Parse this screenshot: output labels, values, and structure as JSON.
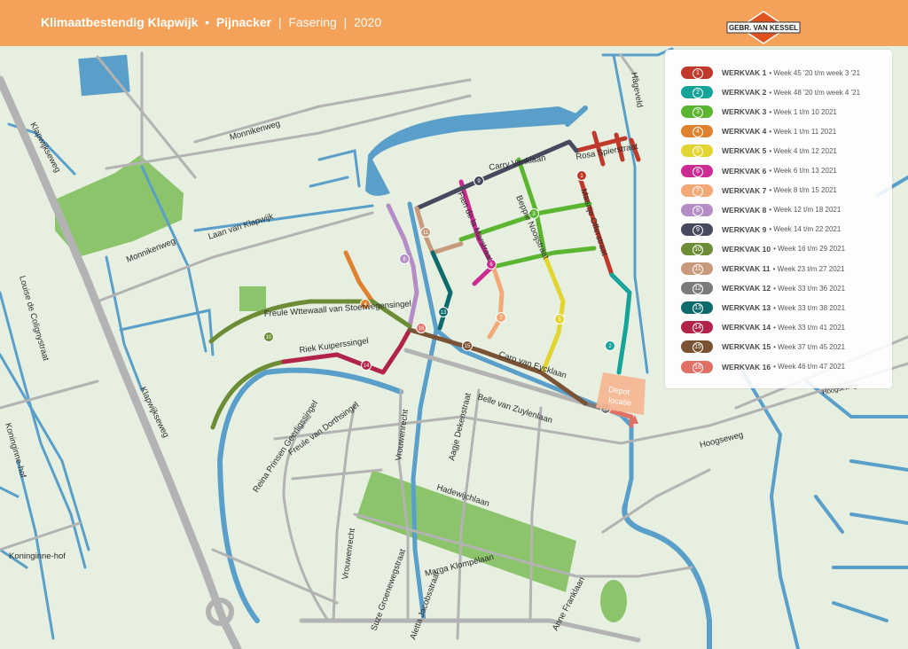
{
  "header": {
    "title": "Klimaatbestendig Klapwijk",
    "place": "Pijnacker",
    "subject": "Fasering",
    "year": "2020",
    "bullet": "•",
    "sep": "|"
  },
  "logo": {
    "text": "GEBR. VAN KESSEL"
  },
  "legend": [
    {
      "n": "1",
      "name": "WERKVAK 1",
      "weeks": "Week 45 '20 t/m week 3 '21",
      "color": "#c0392b"
    },
    {
      "n": "2",
      "name": "WERKVAK 2",
      "weeks": "Week 48 '20 t/m week 4 '21",
      "color": "#16a39a"
    },
    {
      "n": "3",
      "name": "WERKVAK 3",
      "weeks": "Week 1 t/m 10 2021",
      "color": "#5cb531"
    },
    {
      "n": "4",
      "name": "WERKVAK 4",
      "weeks": "Week 1 t/m 11 2021",
      "color": "#e0812f"
    },
    {
      "n": "5",
      "name": "WERKVAK 5",
      "weeks": "Week 4 t/m 12 2021",
      "color": "#e3d530"
    },
    {
      "n": "6",
      "name": "WERKVAK 6",
      "weeks": "Week 6 t/m 13 2021",
      "color": "#cc2b92"
    },
    {
      "n": "7",
      "name": "WERKVAK 7",
      "weeks": "Week 8 t/m 15 2021",
      "color": "#f2a877"
    },
    {
      "n": "8",
      "name": "WERKVAK 8",
      "weeks": "Week 12 t/m 18 2021",
      "color": "#b48cc6"
    },
    {
      "n": "9",
      "name": "WERKVAK 9",
      "weeks": "Week 14 t/m 22 2021",
      "color": "#474a5e"
    },
    {
      "n": "10",
      "name": "WERKVAK 10",
      "weeks": "Week 16 t/m 29 2021",
      "color": "#6c8c35"
    },
    {
      "n": "11",
      "name": "WERKVAK 11",
      "weeks": "Week 23 t/m 27 2021",
      "color": "#c79a7d"
    },
    {
      "n": "12",
      "name": "WERKVAK 12",
      "weeks": "Week 33 t/m 36 2021",
      "color": "#7b7b7b"
    },
    {
      "n": "13",
      "name": "WERKVAK 13",
      "weeks": "Week 33 t/m 38 2021",
      "color": "#0e6b6b"
    },
    {
      "n": "14",
      "name": "WERKVAK 14",
      "weeks": "Week 33 t/m 41 2021",
      "color": "#b2234a"
    },
    {
      "n": "15",
      "name": "WERKVAK 15",
      "weeks": "Week 37 t/m 45 2021",
      "color": "#7a5334"
    },
    {
      "n": "16",
      "name": "WERKVAK 16",
      "weeks": "Week 46 t/m 47 2021",
      "color": "#e07066"
    }
  ],
  "streets": {
    "klapwijkseweg": "Klapwijkseweg",
    "klapwijkseweg2": "Klapwijkseweg",
    "monnikenweg": "Monnikenweg",
    "monnikenweg2": "Monnikenweg",
    "laan_van_klapwijk": "Laan van Klapwijk",
    "hageveld": "Hageveld",
    "rosa_spierstraat": "Rosa Spierstraat",
    "carry_vanklaan": "Carry Vanklaan",
    "fien_de_la_marstraat": "Fien de la Marstraat",
    "beppie_nooijstraat": "Beppie Nooijstraat",
    "maartje_offerstraat": "Maartje Offerstraat",
    "freule_witte": "Freule Wttewaall van Stoetwegensingel",
    "riek_kuipers": "Riek Kuiperssingel",
    "caro_van_eyck": "Caro van Eycklaan",
    "belle_van_zuylen": "Belle van Zuylenlaan",
    "hoogseweg": "Hoogseweg",
    "hoogseweg2": "Hoogseweg",
    "louise": "Louise de Colignystraat",
    "koninginnehof": "Koninginne-hof",
    "koninginnehof2": "Koninginne-hof",
    "reina": "Reina Prinsen Geerligssingel",
    "freule_dorth": "Freule van Dorthsingel",
    "vrouwenrecht": "Vrouwenrecht",
    "vrouwenrecht2": "Vrouwenrecht",
    "aagje": "Aagje Dekenstraat",
    "hadewijch": "Hadewijchlaan",
    "marga": "Marga Klompélaan",
    "suze": "Suze Groenewegstraat",
    "aletta": "Aletta Jacobsstraat",
    "anne": "Anne Franklaan"
  },
  "depot": {
    "line1": "Depot",
    "line2": "locatie"
  }
}
